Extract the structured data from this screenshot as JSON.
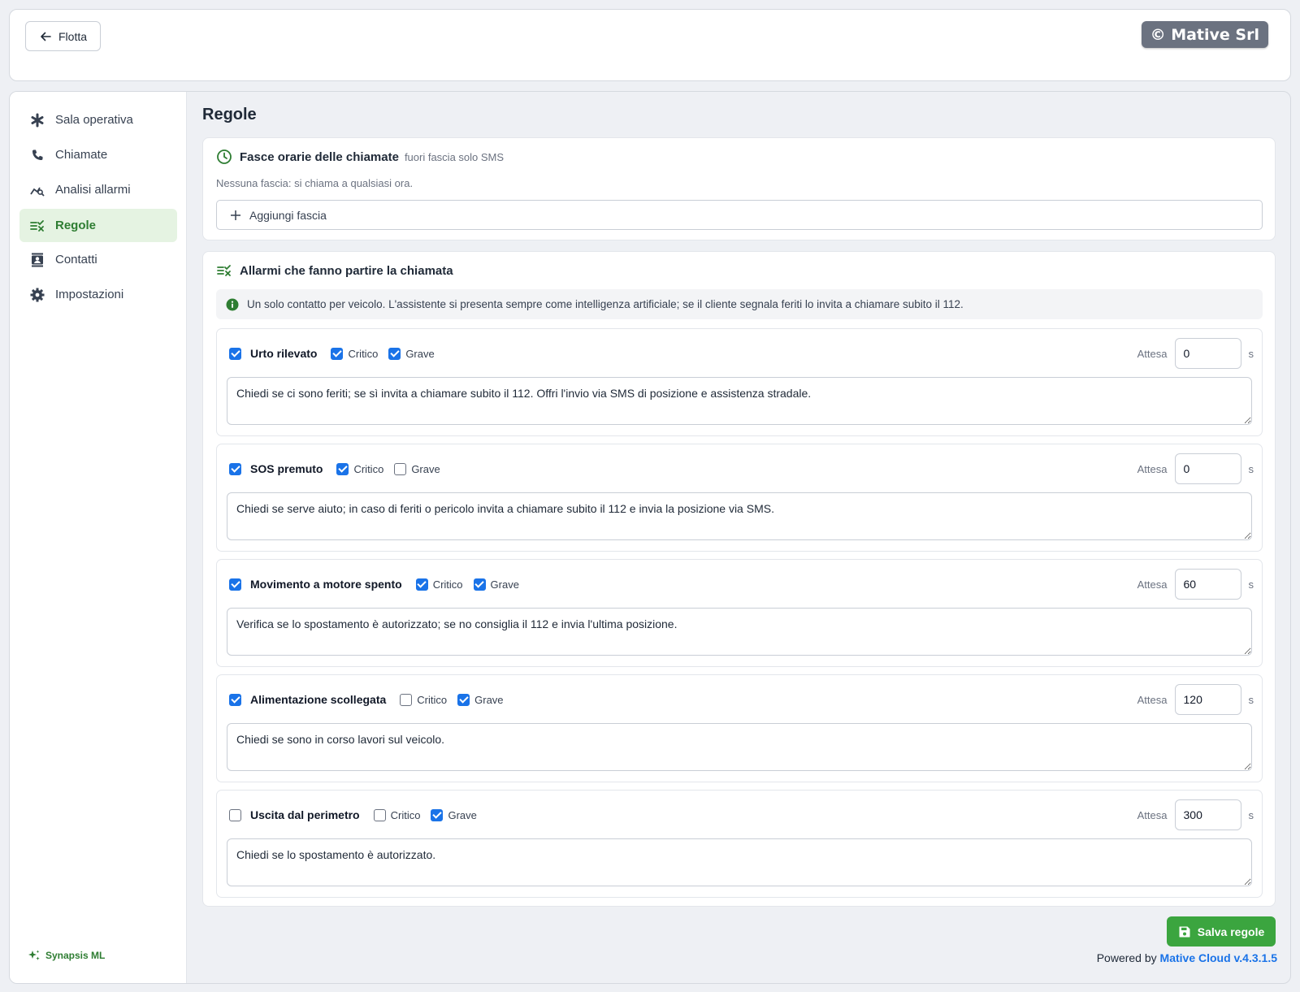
{
  "header": {
    "back_label": "Flotta",
    "copyright": "© Mative Srl"
  },
  "sidebar": {
    "items": [
      {
        "label": "Sala operativa",
        "icon": "asterisk-icon"
      },
      {
        "label": "Chiamate",
        "icon": "phone-icon"
      },
      {
        "label": "Analisi allarmi",
        "icon": "analytics-icon"
      },
      {
        "label": "Regole",
        "icon": "rules-icon",
        "active": true
      },
      {
        "label": "Contatti",
        "icon": "contacts-icon"
      },
      {
        "label": "Impostazioni",
        "icon": "gear-icon"
      }
    ],
    "brand": "Synapsis ML"
  },
  "page": {
    "title": "Regole"
  },
  "time_slots": {
    "title": "Fasce orarie delle chiamate",
    "subtitle": "fuori fascia solo SMS",
    "empty_text": "Nessuna fascia: si chiama a qualsiasi ora.",
    "add_label": "Aggiungi fascia"
  },
  "alarms": {
    "title": "Allarmi che fanno partire la chiamata",
    "info": "Un solo contatto per veicolo. L'assistente si presenta sempre come intelligenza artificiale; se il cliente segnala feriti lo invita a chiamare subito il 112.",
    "critical_label": "Critico",
    "severe_label": "Grave",
    "wait_label": "Attesa",
    "wait_unit": "s",
    "rules": [
      {
        "name": "Urto rilevato",
        "enabled": true,
        "critical": true,
        "severe": true,
        "wait": "0",
        "text": "Chiedi se ci sono feriti; se sì invita a chiamare subito il 112. Offri l'invio via SMS di posizione e assistenza stradale."
      },
      {
        "name": "SOS premuto",
        "enabled": true,
        "critical": true,
        "severe": false,
        "wait": "0",
        "text": "Chiedi se serve aiuto; in caso di feriti o pericolo invita a chiamare subito il 112 e invia la posizione via SMS."
      },
      {
        "name": "Movimento a motore spento",
        "enabled": true,
        "critical": true,
        "severe": true,
        "wait": "60",
        "text": "Verifica se lo spostamento è autorizzato; se no consiglia il 112 e invia l'ultima posizione."
      },
      {
        "name": "Alimentazione scollegata",
        "enabled": true,
        "critical": false,
        "severe": true,
        "wait": "120",
        "text": "Chiedi se sono in corso lavori sul veicolo."
      },
      {
        "name": "Uscita dal perimetro",
        "enabled": false,
        "critical": false,
        "severe": true,
        "wait": "300",
        "text": "Chiedi se lo spostamento è autorizzato."
      }
    ]
  },
  "footer": {
    "save_label": "Salva regole",
    "powered_prefix": "Powered by",
    "powered_product": "Mative Cloud v.4.3.1.5"
  },
  "colors": {
    "accent_green": "#2e7d32",
    "save_green": "#3ba53f",
    "checkbox_blue": "#1a73e8"
  }
}
